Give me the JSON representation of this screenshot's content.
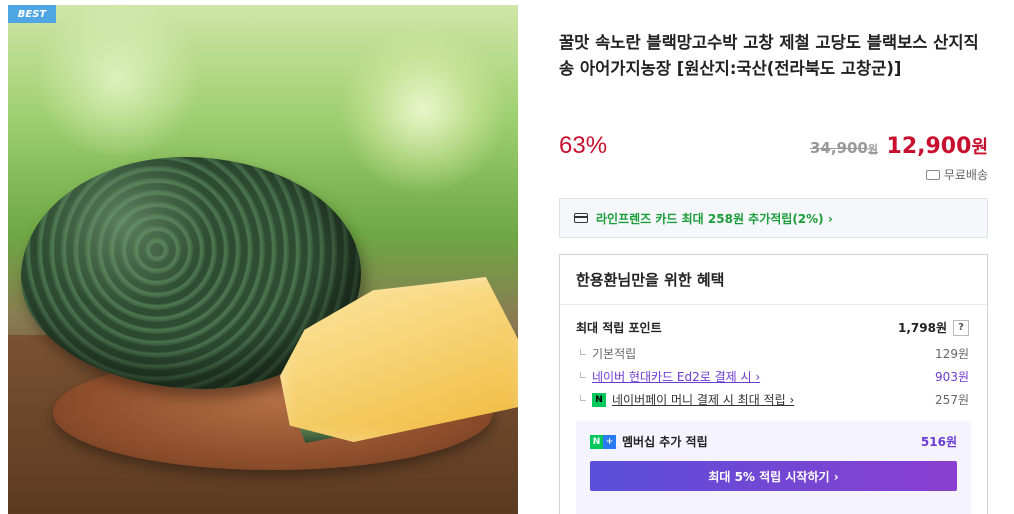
{
  "badge": "BEST",
  "product": {
    "title": "꿀맛 속노란 블랙망고수박 고창 제철 고당도 블랙보스 산지직송 아어가지농장 [원산지:국산(전라북도 고창군)]",
    "discount": "63%",
    "original_price": "34,900",
    "original_unit": "원",
    "final_price": "12,900",
    "final_unit": "원",
    "shipping": "무료배송"
  },
  "card_promo": "라인프렌즈 카드 최대 258원 추가적립(2%) ›",
  "benefit": {
    "title": "한용환님만을 위한 혜택",
    "max_points_label": "최대 적립 포인트",
    "max_points_value": "1,798원",
    "help": "?",
    "rows": [
      {
        "label": "기본적립",
        "value": "129원"
      },
      {
        "label": "네이버 현대카드 Ed2로 결제 시 ›",
        "value": "903원"
      },
      {
        "label": "네이버페이 머니 결제 시 최대 적립 ›",
        "value": "257원",
        "icon": "N"
      }
    ],
    "membership": {
      "label": "멤버십 추가 적립",
      "value": "516원",
      "n": "N",
      "plus": "+",
      "cta": "최대 5% 적립 시작하기 ›"
    }
  },
  "colors": {
    "accent_red": "#c8102e",
    "purple": "#6c3bd1",
    "green": "#1a9d3a",
    "npay_green": "#03c75a"
  }
}
